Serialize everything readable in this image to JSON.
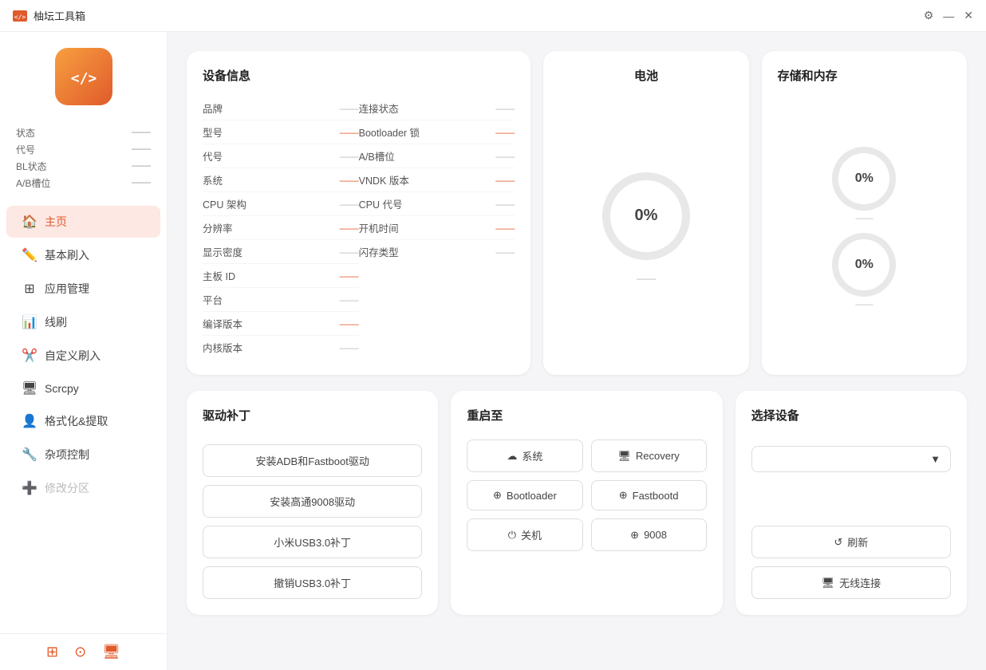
{
  "titlebar": {
    "app_name": "柚坛工具箱",
    "gear_icon": "⚙",
    "min_icon": "—",
    "close_icon": "✕"
  },
  "sidebar": {
    "status_items": [
      {
        "label": "状态",
        "value": "——"
      },
      {
        "label": "代号",
        "value": "——"
      },
      {
        "label": "BL状态",
        "value": "——"
      },
      {
        "label": "A/B槽位",
        "value": "——"
      }
    ],
    "nav_items": [
      {
        "id": "home",
        "icon": "🏠",
        "label": "主页",
        "active": true
      },
      {
        "id": "flash",
        "icon": "✏",
        "label": "基本刷入",
        "active": false
      },
      {
        "id": "appmanage",
        "icon": "⊞",
        "label": "应用管理",
        "active": false
      },
      {
        "id": "cable",
        "icon": "📊",
        "label": "线刷",
        "active": false
      },
      {
        "id": "custom",
        "icon": "✂",
        "label": "自定义刷入",
        "active": false
      },
      {
        "id": "scrcpy",
        "icon": "🖥",
        "label": "Scrcpy",
        "active": false
      },
      {
        "id": "format",
        "icon": "👤",
        "label": "格式化&提取",
        "active": false
      },
      {
        "id": "misc",
        "icon": "🔧",
        "label": "杂项控制",
        "active": false
      },
      {
        "id": "partition",
        "icon": "➕",
        "label": "修改分区",
        "active": false,
        "disabled": true
      }
    ],
    "bottom_icons": [
      "terminal",
      "github",
      "device"
    ]
  },
  "device_info": {
    "title": "设备信息",
    "left_rows": [
      {
        "label": "品牌",
        "value": "——",
        "red": false
      },
      {
        "label": "型号",
        "value": "——",
        "red": true
      },
      {
        "label": "代号",
        "value": "——",
        "red": false
      },
      {
        "label": "系统",
        "value": "——",
        "red": true
      },
      {
        "label": "CPU 架构",
        "value": "——",
        "red": false
      },
      {
        "label": "分辨率",
        "value": "——",
        "red": true
      },
      {
        "label": "显示密度",
        "value": "——",
        "red": false
      },
      {
        "label": "主板 ID",
        "value": "——",
        "red": true
      },
      {
        "label": "平台",
        "value": "——",
        "red": false
      },
      {
        "label": "编译版本",
        "value": "——",
        "red": true
      },
      {
        "label": "内核版本",
        "value": "——",
        "red": false
      }
    ],
    "right_rows": [
      {
        "label": "连接状态",
        "value": "——",
        "red": false
      },
      {
        "label": "Bootloader 锁",
        "value": "——",
        "red": true
      },
      {
        "label": "A/B槽位",
        "value": "——",
        "red": false
      },
      {
        "label": "VNDK 版本",
        "value": "——",
        "red": true
      },
      {
        "label": "CPU 代号",
        "value": "——",
        "red": false
      },
      {
        "label": "开机时间",
        "value": "——",
        "red": true
      },
      {
        "label": "闪存类型",
        "value": "——",
        "red": false
      }
    ]
  },
  "battery": {
    "title": "电池",
    "percent": "0%",
    "info": "——"
  },
  "storage": {
    "title": "存储和内存",
    "storage_percent": "0%",
    "storage_info": "——",
    "memory_percent": "0%",
    "memory_info": "——"
  },
  "driver_patch": {
    "title": "驱动补丁",
    "buttons": [
      "安装ADB和Fastboot驱动",
      "安装高通9008驱动",
      "小米USB3.0补丁",
      "撤销USB3.0补丁"
    ]
  },
  "reboot": {
    "title": "重启至",
    "buttons": [
      {
        "icon": "☁",
        "label": "系统"
      },
      {
        "icon": "🖥",
        "label": "Recovery"
      },
      {
        "icon": "⊕",
        "label": "Bootloader"
      },
      {
        "icon": "⊕",
        "label": "Fastbootd"
      },
      {
        "icon": "⏻",
        "label": "关机"
      },
      {
        "icon": "⊕",
        "label": "9008"
      }
    ]
  },
  "select_device": {
    "title": "选择设备",
    "dropdown_placeholder": "",
    "dropdown_arrow": "▼",
    "buttons": [
      {
        "icon": "↺",
        "label": "刷新"
      },
      {
        "icon": "🖥",
        "label": "无线连接"
      }
    ]
  }
}
